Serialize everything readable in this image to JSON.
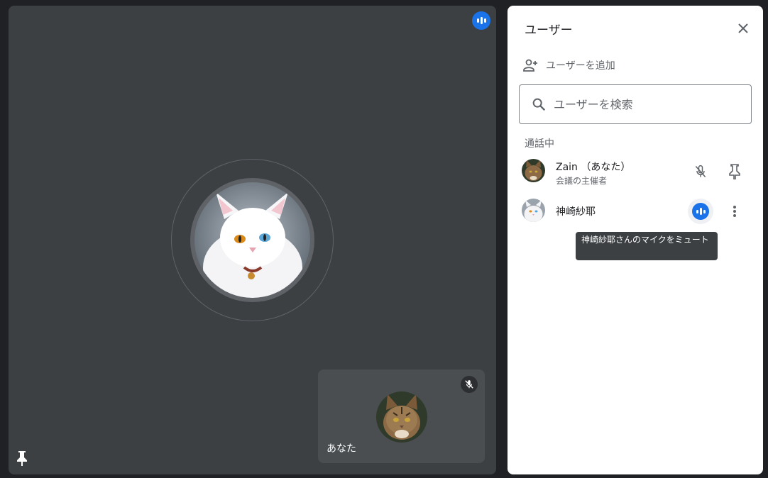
{
  "stage": {
    "speaking_icon": "speaking-indicator-icon",
    "pin_icon": "pin-icon",
    "self_tile": {
      "label": "あなた",
      "mute_icon": "mic-off-icon"
    }
  },
  "panel": {
    "title": "ユーザー",
    "close_icon": "close-icon",
    "add_user_label": "ユーザーを追加",
    "search_placeholder": "ユーザーを検索",
    "section_label": "通話中",
    "participants": [
      {
        "name": "Zain （あなた）",
        "subtitle": "会議の主催者",
        "mic_state": "muted",
        "action": "pin"
      },
      {
        "name": "神崎紗耶",
        "subtitle": "",
        "mic_state": "speaking",
        "action": "more"
      }
    ],
    "tooltip": "神崎紗耶さんのマイクをミュート"
  },
  "colors": {
    "stage_bg": "#3c4043",
    "app_bg": "#202124",
    "accent": "#1a73e8",
    "self_tile_bg": "#4a4e51"
  }
}
